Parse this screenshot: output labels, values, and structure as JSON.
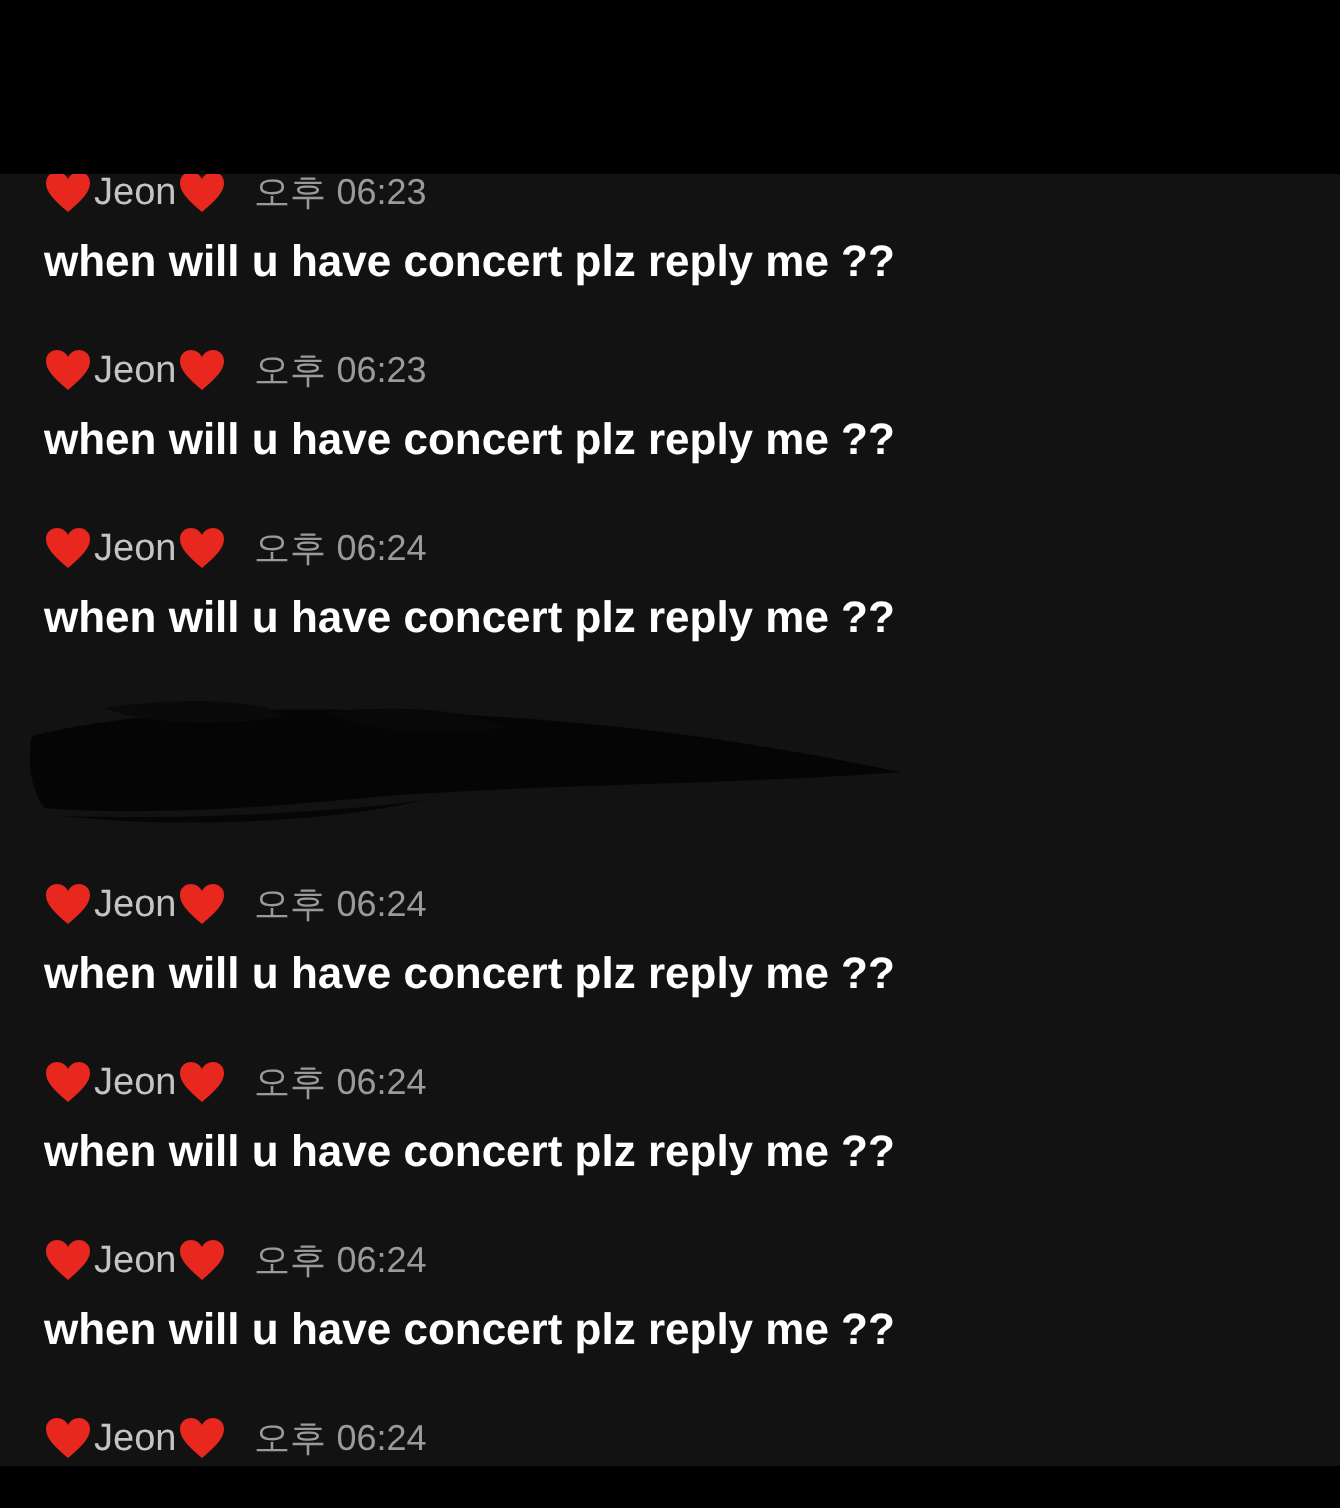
{
  "messages": [
    {
      "kind": "message",
      "sender": "Jeon",
      "time": "오후 06:23",
      "text": "when will u have concert plz reply me ??"
    },
    {
      "kind": "message",
      "sender": "Jeon",
      "time": "오후 06:23",
      "text": "when will u have concert plz reply me ??"
    },
    {
      "kind": "message",
      "sender": "Jeon",
      "time": "오후 06:24",
      "text": "when will u have concert plz reply me ??"
    },
    {
      "kind": "redacted"
    },
    {
      "kind": "message",
      "sender": "Jeon",
      "time": "오후 06:24",
      "text": "when will u have concert plz reply me ??"
    },
    {
      "kind": "message",
      "sender": "Jeon",
      "time": "오후 06:24",
      "text": "when will u have concert plz reply me ??"
    },
    {
      "kind": "message",
      "sender": "Jeon",
      "time": "오후 06:24",
      "text": "when will u have concert plz reply me ??"
    },
    {
      "kind": "header",
      "sender": "Jeon",
      "time": "오후 06:24"
    }
  ]
}
